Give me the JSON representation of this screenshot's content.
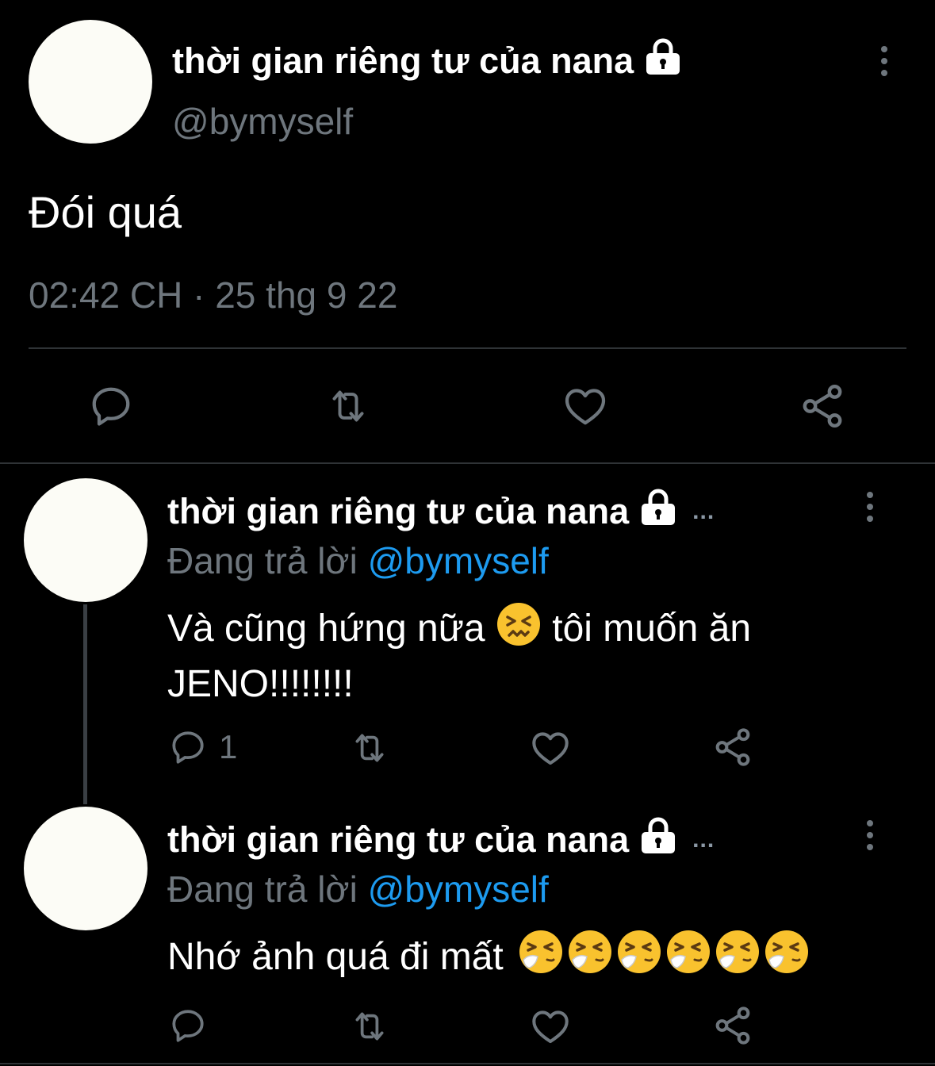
{
  "main_tweet": {
    "display_name": "thời gian riêng tư của nana",
    "handle": "@bymyself",
    "text": "Đói quá",
    "timestamp": "02:42 CH · 25 thg 9 22",
    "icons": [
      "lock-icon",
      "more-icon",
      "reply-icon",
      "retweet-icon",
      "like-icon",
      "share-icon"
    ]
  },
  "replies": [
    {
      "display_name": "thời gian riêng tư của nana",
      "ellipsis": "...",
      "replying_prefix": "Đang trả lời",
      "replying_to": "@bymyself",
      "text_line1": "Và cũng hứng nữa",
      "text_line1b": "tôi muốn ăn",
      "text_line2": "JENO!!!!!!!!",
      "emoji": "confounded-face",
      "reply_count": "1"
    },
    {
      "display_name": "thời gian riêng tư của nana",
      "ellipsis": "...",
      "replying_prefix": "Đang trả lời",
      "replying_to": "@bymyself",
      "text": "Nhớ ảnh quá đi mất",
      "emoji": "sneezing-face",
      "emoji_count": 6
    }
  ],
  "colors": {
    "background": "#000000",
    "text": "#ffffff",
    "muted": "#6e767d",
    "link": "#1d9bf0",
    "divider": "#2f3336",
    "avatar": "#fcfcf6"
  }
}
